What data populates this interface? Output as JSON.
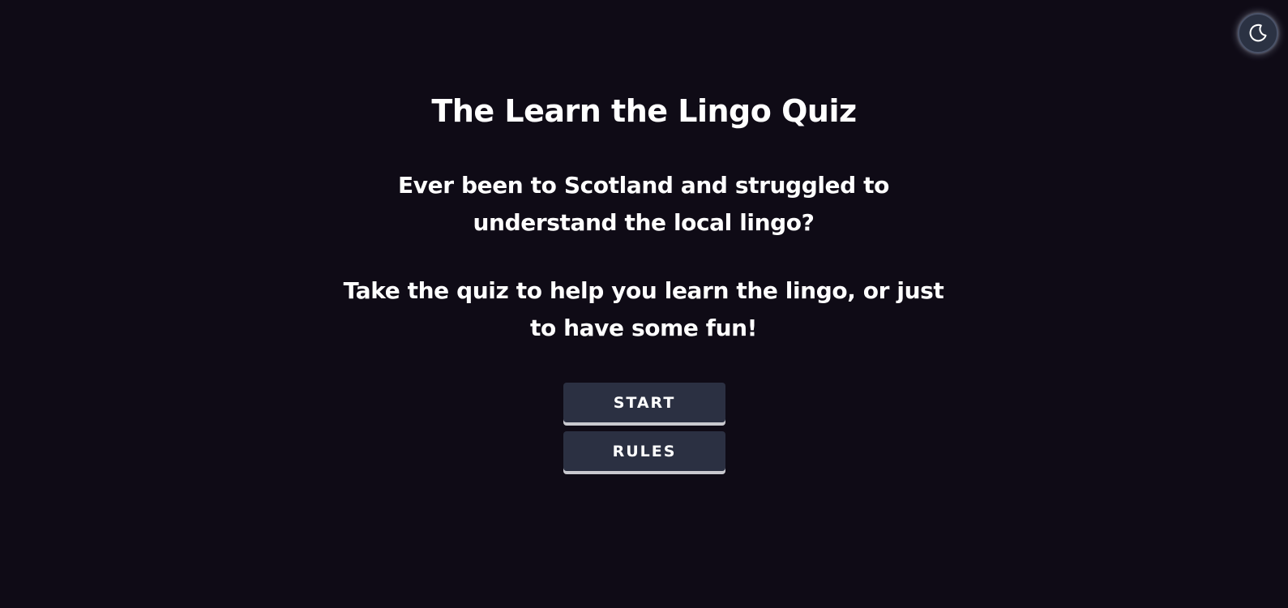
{
  "theme_toggle": {
    "icon": "moon-icon",
    "accent": "#2b3243"
  },
  "main": {
    "title": "The Learn the Lingo Quiz",
    "intro_line1": "Ever been to Scotland and struggled to",
    "intro_line2": "understand the local lingo?",
    "cta_line1": "Take the quiz to help you learn the lingo, or just",
    "cta_line2": "to have some fun!"
  },
  "buttons": {
    "start_label": "START",
    "rules_label": "RULES"
  },
  "colors": {
    "background": "#0f0b16",
    "button": "#2b3042",
    "text": "#ffffff"
  }
}
